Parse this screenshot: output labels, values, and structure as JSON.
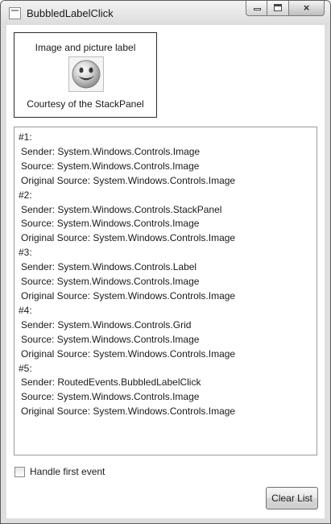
{
  "window": {
    "title": "BubbledLabelClick",
    "controls": {
      "minimize": "minimize",
      "maximize": "maximize",
      "close": "×"
    }
  },
  "label": {
    "top_text": "Image and picture label",
    "image_icon": "smiley-face-icon",
    "bottom_text": "Courtesy of the StackPanel"
  },
  "events": [
    {
      "header": "#1:",
      "sender": "Sender: System.Windows.Controls.Image",
      "source": "Source: System.Windows.Controls.Image",
      "original": "Original Source: System.Windows.Controls.Image"
    },
    {
      "header": "#2:",
      "sender": "Sender: System.Windows.Controls.StackPanel",
      "source": "Source: System.Windows.Controls.Image",
      "original": "Original Source: System.Windows.Controls.Image"
    },
    {
      "header": "#3:",
      "sender": "Sender: System.Windows.Controls.Label",
      "source": "Source: System.Windows.Controls.Image",
      "original": "Original Source: System.Windows.Controls.Image"
    },
    {
      "header": "#4:",
      "sender": "Sender: System.Windows.Controls.Grid",
      "source": "Source: System.Windows.Controls.Image",
      "original": "Original Source: System.Windows.Controls.Image"
    },
    {
      "header": "#5:",
      "sender": "Sender: RoutedEvents.BubbledLabelClick",
      "source": "Source: System.Windows.Controls.Image",
      "original": "Original Source: System.Windows.Controls.Image"
    }
  ],
  "options": {
    "handle_first_event_label": "Handle first event",
    "handle_first_event_checked": false
  },
  "actions": {
    "clear_label": "Clear List"
  }
}
